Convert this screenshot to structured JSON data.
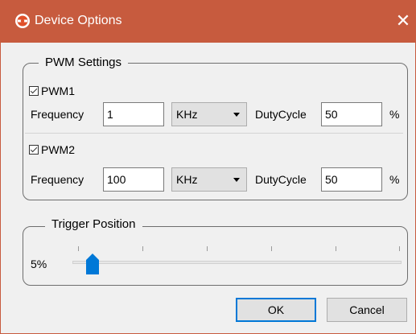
{
  "window": {
    "title": "Device Options",
    "close_glyph": "✕",
    "app_icon": "device-logo-icon",
    "accent_color": "#c75b3e"
  },
  "pwm_settings": {
    "group_title": "PWM Settings",
    "pwm1": {
      "label": "PWM1",
      "checked": true,
      "frequency_label": "Frequency",
      "frequency_value": "1",
      "unit": "KHz",
      "duty_label": "DutyCycle",
      "duty_value": "50",
      "percent": "%"
    },
    "pwm2": {
      "label": "PWM2",
      "checked": true,
      "frequency_label": "Frequency",
      "frequency_value": "100",
      "unit": "KHz",
      "duty_label": "DutyCycle",
      "duty_value": "50",
      "percent": "%"
    }
  },
  "trigger": {
    "group_title": "Trigger Position",
    "value_label": "5%",
    "value": 5,
    "slider_color": "#0078d7"
  },
  "buttons": {
    "ok": "OK",
    "cancel": "Cancel"
  }
}
